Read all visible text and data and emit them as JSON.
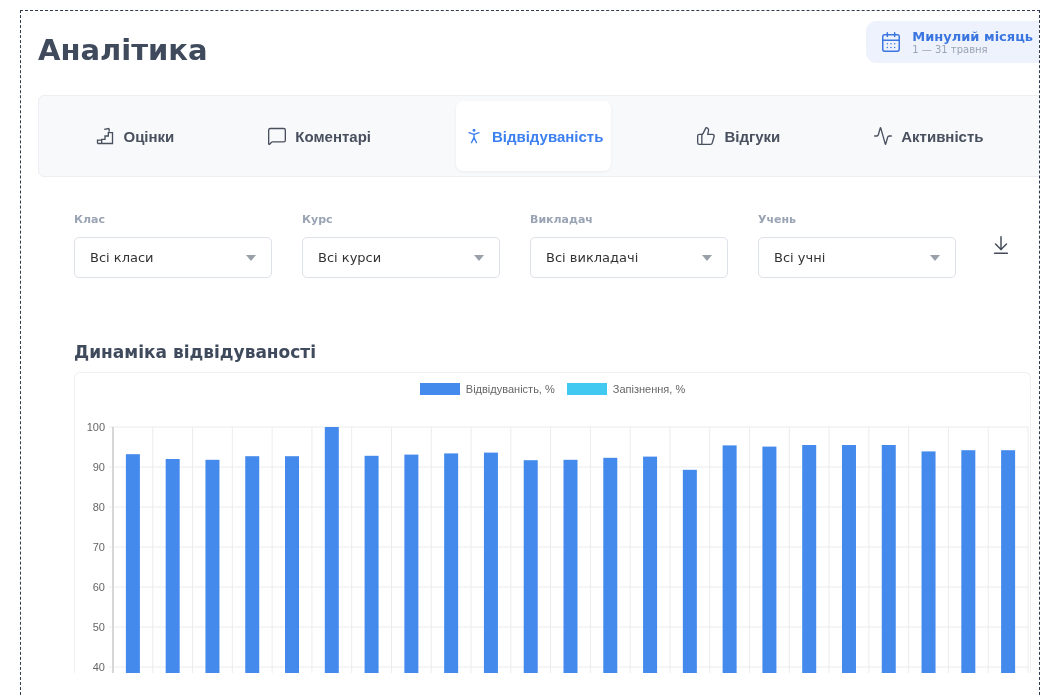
{
  "page": {
    "title": "Аналітика"
  },
  "period": {
    "label": "Минулий місяць",
    "range": "1 — 31 травня"
  },
  "tabs": [
    {
      "label": "Оцінки",
      "kind": "grades",
      "selected": false
    },
    {
      "label": "Коментарі",
      "kind": "comments",
      "selected": false
    },
    {
      "label": "Відвідуваність",
      "kind": "attendance",
      "selected": true
    },
    {
      "label": "Відгуки",
      "kind": "feedback",
      "selected": false
    },
    {
      "label": "Активність",
      "kind": "activity",
      "selected": false
    }
  ],
  "filters": [
    {
      "label": "Клас",
      "value": "Всі класи"
    },
    {
      "label": "Курс",
      "value": "Всі курси"
    },
    {
      "label": "Викладач",
      "value": "Всі викладачі"
    },
    {
      "label": "Учень",
      "value": "Всі учні"
    }
  ],
  "chart": {
    "title": "Динаміка відвідуваності",
    "chart_data": {
      "type": "bar",
      "grid": true,
      "ylim": [
        0,
        100
      ],
      "yticks": [
        40,
        50,
        60,
        70,
        80,
        90,
        100
      ],
      "series": [
        {
          "name": "Відвідуваність, %",
          "color": "#448aed",
          "values": [
            93.2,
            92,
            91.8,
            92.7,
            92.7,
            100,
            92.8,
            93.1,
            93.4,
            93.6,
            91.7,
            91.8,
            92.3,
            92.6,
            89.3,
            95.4,
            95.1,
            95.5,
            95.5,
            95.5,
            93.9,
            94.2,
            94.2
          ]
        },
        {
          "name": "Запізнення, %",
          "color": "#41c9f2",
          "values": [
            null,
            null,
            null,
            null,
            null,
            null,
            null,
            null,
            null,
            null,
            null,
            null,
            null,
            null,
            null,
            null,
            null,
            null,
            null,
            null,
            null,
            null,
            null
          ]
        }
      ]
    }
  }
}
